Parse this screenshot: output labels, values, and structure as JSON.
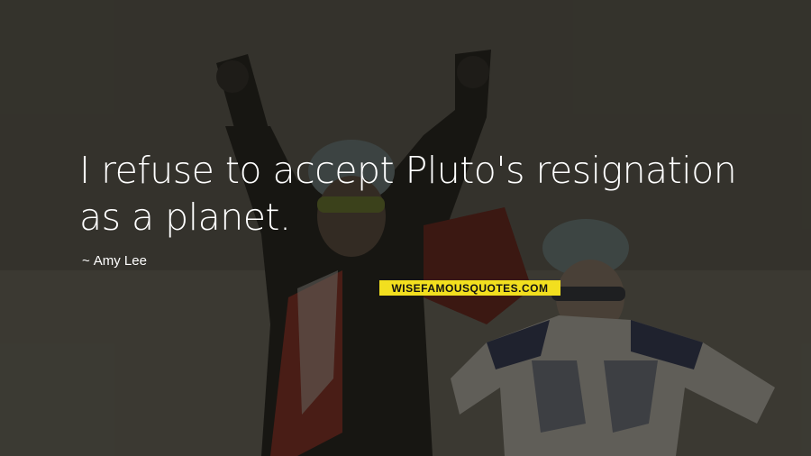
{
  "quote": {
    "text": "I refuse to accept Pluto's resignation as a planet.",
    "author_prefix": "~",
    "author": "Amy Lee"
  },
  "watermark": {
    "text": "WISEFAMOUSQUOTES.COM",
    "color": "#f2df1f"
  },
  "background": {
    "description_colors": {
      "ice": "#8c8b80",
      "jersey_red": "#9c2a20",
      "jersey_white": "#d9d6cf"
    }
  }
}
